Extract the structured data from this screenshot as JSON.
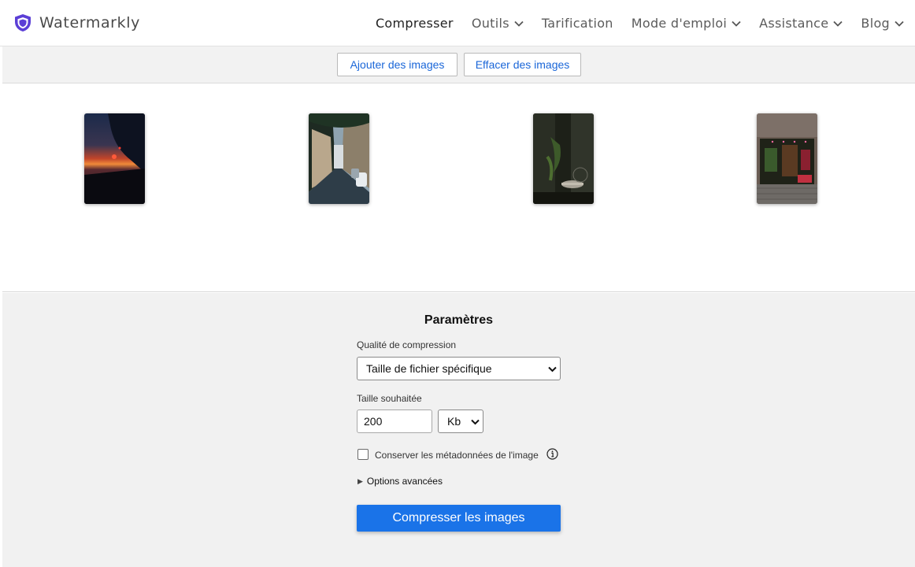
{
  "brand": {
    "name": "Watermarkly",
    "icon": "shield-icon",
    "color": "#5b3fd6"
  },
  "nav": {
    "items": [
      {
        "label": "Compresser",
        "dropdown": false,
        "active": true
      },
      {
        "label": "Outils",
        "dropdown": true,
        "active": false
      },
      {
        "label": "Tarification",
        "dropdown": false,
        "active": false
      },
      {
        "label": "Mode d'emploi",
        "dropdown": true,
        "active": false
      },
      {
        "label": "Assistance",
        "dropdown": true,
        "active": false
      },
      {
        "label": "Blog",
        "dropdown": true,
        "active": false
      }
    ]
  },
  "toolbar": {
    "add_label": "Ajouter des images",
    "clear_label": "Effacer des images"
  },
  "gallery": {
    "images": [
      {
        "subject": "sunset-window-photo"
      },
      {
        "subject": "city-street-photo"
      },
      {
        "subject": "cafe-interior-photo"
      },
      {
        "subject": "shopfront-photo"
      }
    ]
  },
  "settings": {
    "title": "Paramètres",
    "quality_label": "Qualité de compression",
    "quality_value": "Taille de fichier spécifique",
    "size_label": "Taille souhaitée",
    "size_value": "200",
    "unit_value": "Kb",
    "metadata_label": "Conserver les métadonnées de l'image",
    "metadata_checked": false,
    "advanced_label": "Options avancées",
    "compress_label": "Compresser les images"
  },
  "colors": {
    "accent": "#1a73e8",
    "link": "#1a66d8",
    "panel_bg": "#f1f1f1"
  }
}
